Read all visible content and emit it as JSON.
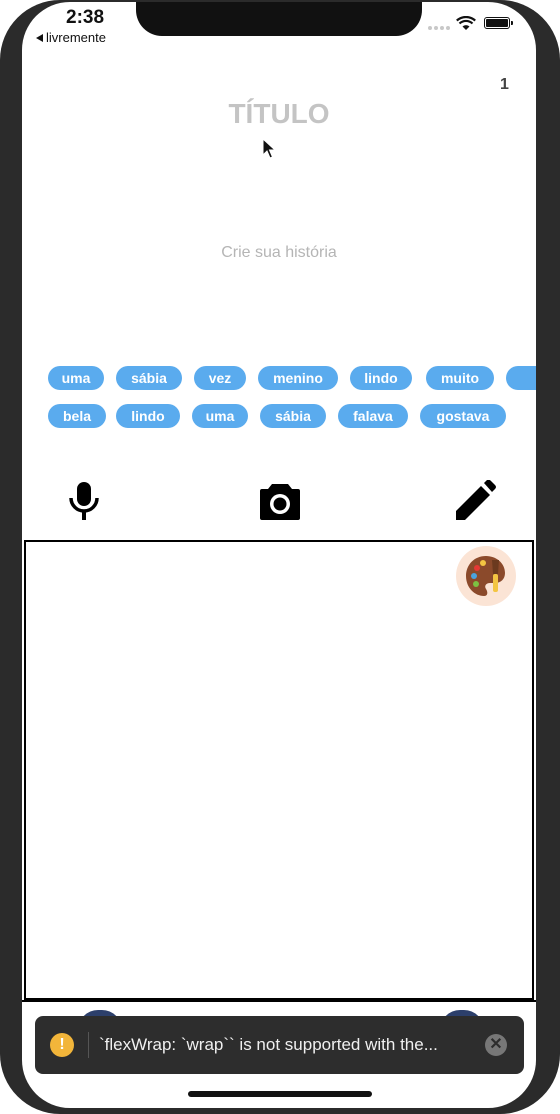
{
  "status_bar": {
    "time": "2:38",
    "back_label": "livremente"
  },
  "header": {
    "page_number": "1",
    "title_placeholder": "TÍTULO"
  },
  "editor": {
    "story_placeholder": "Crie sua história"
  },
  "word_chips": {
    "row1": [
      "uma",
      "sábia",
      "vez",
      "menino",
      "lindo",
      "muito"
    ],
    "row2": [
      "bela",
      "lindo",
      "uma",
      "sábia",
      "falava",
      "gostava"
    ],
    "chip_color": "#5aabee"
  },
  "toolbar": {
    "icons": [
      "microphone-icon",
      "camera-icon",
      "pencil-icon"
    ]
  },
  "drawing": {
    "palette_icon": "palette-icon"
  },
  "toast": {
    "message": "`flexWrap: `wrap`` is not supported with the..."
  }
}
